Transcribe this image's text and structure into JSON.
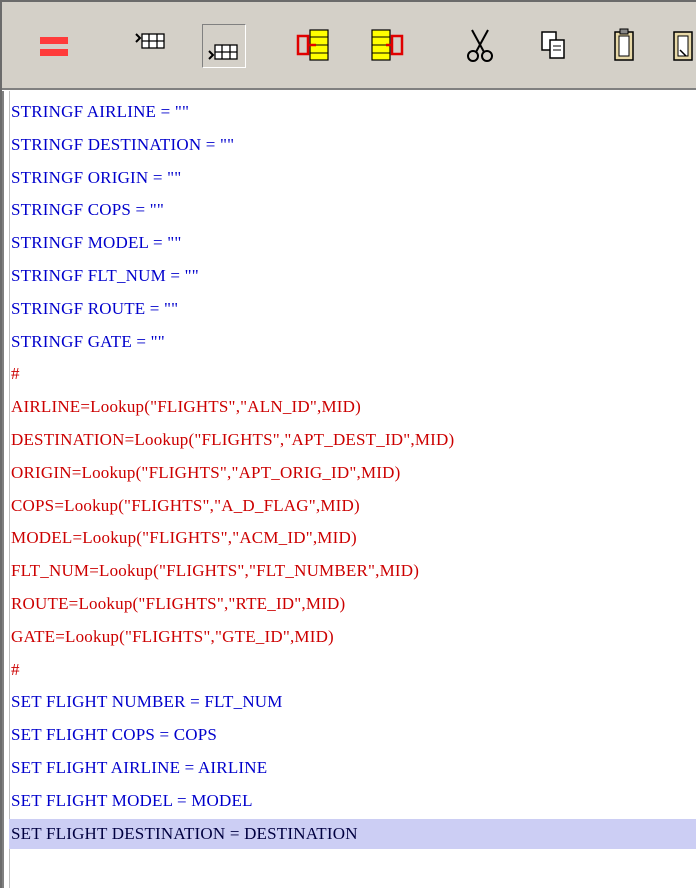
{
  "toolbar": {
    "buttons": [
      {
        "name": "equals-icon"
      },
      {
        "name": "insert-row-before-icon"
      },
      {
        "name": "insert-row-after-icon"
      },
      {
        "name": "move-block-right-icon"
      },
      {
        "name": "move-block-left-icon"
      },
      {
        "name": "cut-icon"
      },
      {
        "name": "copy-icon"
      },
      {
        "name": "paste-icon"
      },
      {
        "name": "paste-special-icon"
      }
    ]
  },
  "editor": {
    "lines": [
      {
        "text": "STRINGF AIRLINE = \"\"",
        "color": "blue"
      },
      {
        "text": "STRINGF DESTINATION = \"\"",
        "color": "blue"
      },
      {
        "text": "STRINGF ORIGIN = \"\"",
        "color": "blue"
      },
      {
        "text": "STRINGF COPS = \"\"",
        "color": "blue"
      },
      {
        "text": "STRINGF MODEL = \"\"",
        "color": "blue"
      },
      {
        "text": "STRINGF FLT_NUM = \"\"",
        "color": "blue"
      },
      {
        "text": "STRINGF ROUTE = \"\"",
        "color": "blue"
      },
      {
        "text": "STRINGF GATE = \"\"",
        "color": "blue"
      },
      {
        "text": "#",
        "color": "red"
      },
      {
        "text": "AIRLINE=Lookup(\"FLIGHTS\",\"ALN_ID\",MID)",
        "color": "red"
      },
      {
        "text": "DESTINATION=Lookup(\"FLIGHTS\",\"APT_DEST_ID\",MID)",
        "color": "red"
      },
      {
        "text": "ORIGIN=Lookup(\"FLIGHTS\",\"APT_ORIG_ID\",MID)",
        "color": "red"
      },
      {
        "text": "COPS=Lookup(\"FLIGHTS\",\"A_D_FLAG\",MID)",
        "color": "red"
      },
      {
        "text": "MODEL=Lookup(\"FLIGHTS\",\"ACM_ID\",MID)",
        "color": "red"
      },
      {
        "text": "FLT_NUM=Lookup(\"FLIGHTS\",\"FLT_NUMBER\",MID)",
        "color": "red"
      },
      {
        "text": "ROUTE=Lookup(\"FLIGHTS\",\"RTE_ID\",MID)",
        "color": "red"
      },
      {
        "text": "GATE=Lookup(\"FLIGHTS\",\"GTE_ID\",MID)",
        "color": "red"
      },
      {
        "text": "#",
        "color": "red"
      },
      {
        "text": "SET FLIGHT NUMBER = FLT_NUM",
        "color": "blue"
      },
      {
        "text": "SET FLIGHT COPS = COPS",
        "color": "blue"
      },
      {
        "text": "SET FLIGHT AIRLINE = AIRLINE",
        "color": "blue"
      },
      {
        "text": "SET FLIGHT MODEL = MODEL",
        "color": "blue"
      },
      {
        "text": "SET FLIGHT DESTINATION = DESTINATION",
        "color": "dark",
        "selected": true
      }
    ],
    "highlight_color": "#cccef4"
  },
  "colors": {
    "blue": "#0000cc",
    "red": "#cc0000",
    "toolbar_bg": "#d4d0c8"
  }
}
